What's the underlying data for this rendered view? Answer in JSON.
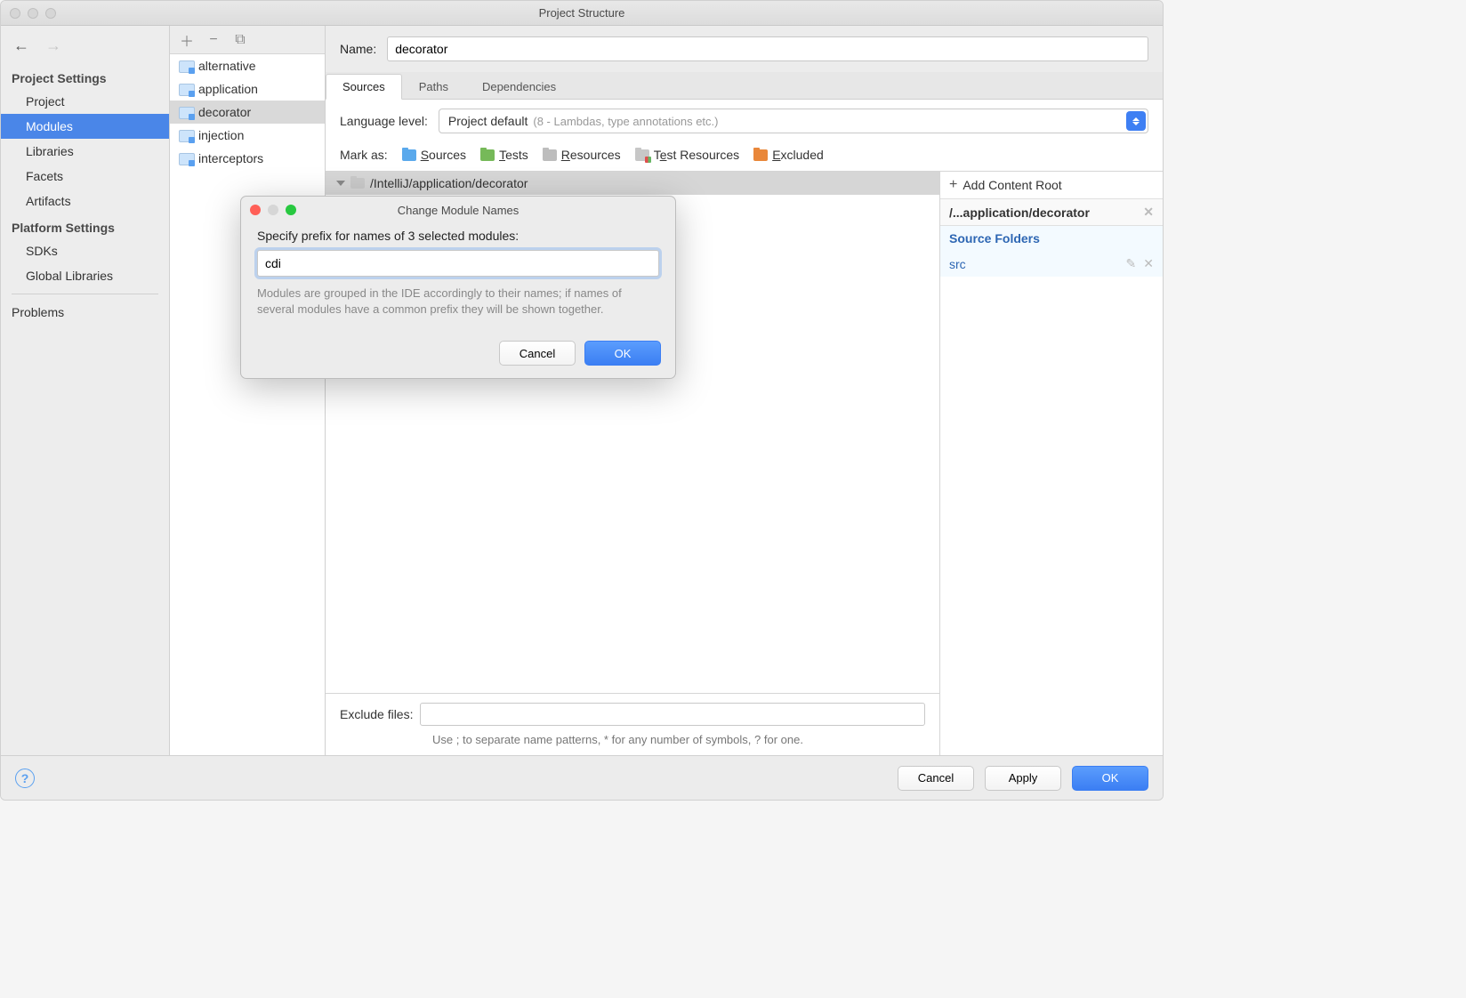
{
  "window": {
    "title": "Project Structure"
  },
  "sidebar": {
    "section1_header": "Project Settings",
    "section1_items": [
      "Project",
      "Modules",
      "Libraries",
      "Facets",
      "Artifacts"
    ],
    "section1_selected": 1,
    "section2_header": "Platform Settings",
    "section2_items": [
      "SDKs",
      "Global Libraries"
    ],
    "problems_label": "Problems"
  },
  "modules": {
    "items": [
      "alternative",
      "application",
      "decorator",
      "injection",
      "interceptors"
    ],
    "selected": 2
  },
  "main": {
    "name_label": "Name:",
    "name_value": "decorator",
    "tabs": [
      "Sources",
      "Paths",
      "Dependencies"
    ],
    "active_tab": 0,
    "language_label": "Language level:",
    "language_value": "Project default",
    "language_hint": "(8 - Lambdas, type annotations etc.)",
    "markas_label": "Mark as:",
    "markas": {
      "sources": "Sources",
      "tests": "Tests",
      "resources": "Resources",
      "test_resources": "Test Resources",
      "excluded": "Excluded"
    },
    "tree_path": "/IntelliJ/application/decorator",
    "exclude_label": "Exclude files:",
    "exclude_value": "",
    "exclude_hint": "Use ; to separate name patterns, * for any number of symbols, ? for one."
  },
  "right": {
    "add_root": "Add Content Root",
    "path": "/...application/decorator",
    "source_folders_header": "Source Folders",
    "src_name": "src"
  },
  "footer": {
    "cancel": "Cancel",
    "apply": "Apply",
    "ok": "OK"
  },
  "dialog": {
    "title": "Change Module Names",
    "label": "Specify prefix for names of 3 selected modules:",
    "value": "cdi",
    "hint": "Modules are grouped in the IDE accordingly to their names; if names of several modules have a common prefix they will be shown together.",
    "cancel": "Cancel",
    "ok": "OK"
  }
}
